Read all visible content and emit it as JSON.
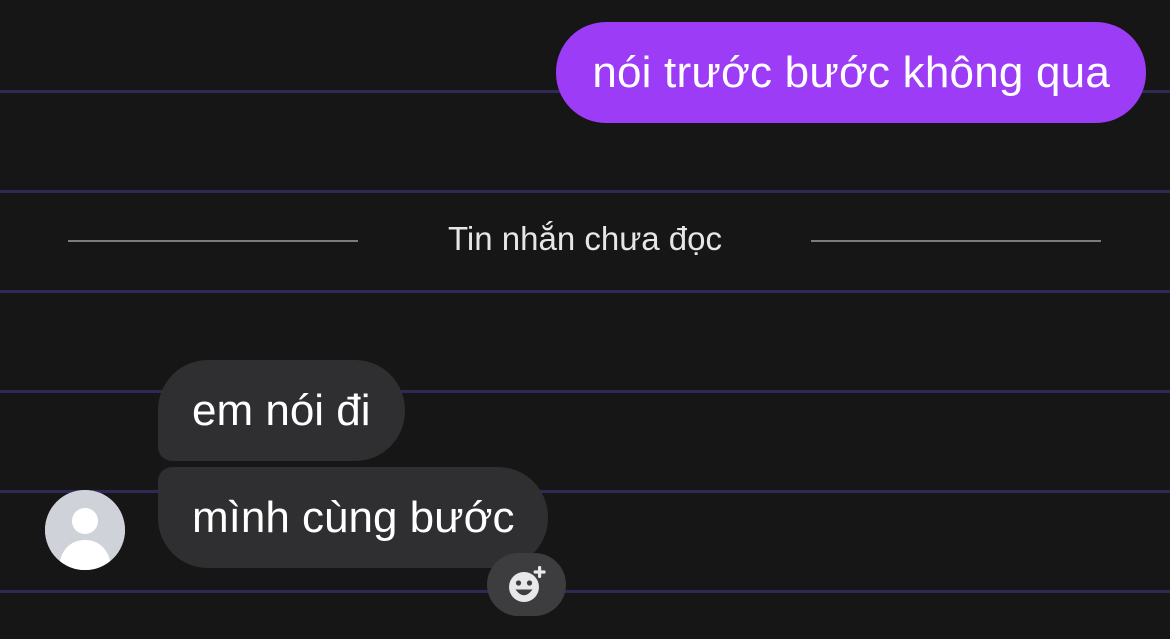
{
  "colors": {
    "background": "#161616",
    "outgoing_bubble": "#9d3cf6",
    "incoming_bubble": "#2f2f31",
    "text": "#ffffff"
  },
  "messages": {
    "outgoing": [
      {
        "text": "nói trước bước không qua"
      }
    ],
    "divider_label": "Tin nhắn chưa đọc",
    "incoming": [
      {
        "text": "em nói đi"
      },
      {
        "text": "mình cùng bước"
      }
    ]
  },
  "icons": {
    "avatar": "default-person-avatar",
    "reaction": "add-reaction-smiley-icon"
  }
}
